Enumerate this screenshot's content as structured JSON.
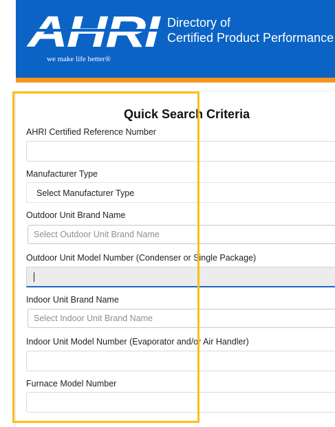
{
  "header": {
    "logo_text": "AHRI",
    "tagline": "we make life better®",
    "title_line1": "Directory of",
    "title_line2": "Certified Product Performance",
    "colors": {
      "header_blue": "#0b63c5",
      "accent_orange": "#f7941d"
    }
  },
  "search": {
    "title": "Quick Search Criteria",
    "fields": {
      "reference_number": {
        "label": "AHRI Certified Reference Number",
        "value": ""
      },
      "manufacturer_type": {
        "label": "Manufacturer Type",
        "selected": "Select Manufacturer Type"
      },
      "outdoor_brand": {
        "label": "Outdoor Unit Brand Name",
        "placeholder": "Select Outdoor Unit Brand Name"
      },
      "outdoor_model": {
        "label": "Outdoor Unit Model Number (Condenser or Single Package)",
        "value": ""
      },
      "indoor_brand": {
        "label": "Indoor Unit Brand Name",
        "placeholder": "Select Indoor Unit Brand Name"
      },
      "indoor_model": {
        "label": "Indoor Unit Model Number (Evaporator and/or Air Handler)",
        "value": ""
      },
      "furnace_model": {
        "label": "Furnace Model Number",
        "value": ""
      }
    }
  },
  "highlight_color": "#fbbf14"
}
